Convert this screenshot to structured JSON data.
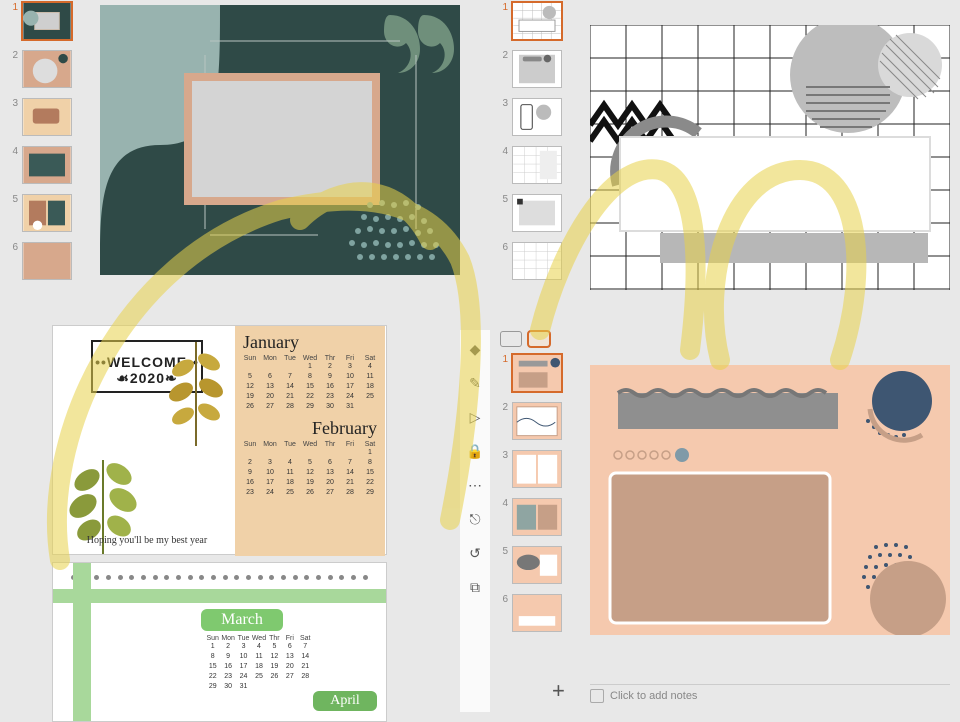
{
  "panel_tl": {
    "thumbs": [
      1,
      2,
      3,
      4,
      5,
      6
    ],
    "selected": 1
  },
  "panel_tr": {
    "thumbs": [
      1,
      2,
      3,
      4,
      5,
      6
    ],
    "selected": 1
  },
  "panel_br": {
    "thumbs": [
      1,
      2,
      3,
      4,
      5,
      6
    ],
    "selected": 1,
    "notes_placeholder": "Click to add notes",
    "add_slide_glyph": "+"
  },
  "calendar": {
    "welcome_title": "••WELCOME••",
    "welcome_year": "☙2020❧",
    "welcome_msg": "Hoping you'll be my best year",
    "months": {
      "jan": {
        "label": "January",
        "dow": [
          "Sun",
          "Mon",
          "Tue",
          "Wed",
          "Thr",
          "Fri",
          "Sat"
        ],
        "rows": [
          [
            "",
            "",
            "",
            "1",
            "2",
            "3",
            "4"
          ],
          [
            "5",
            "6",
            "7",
            "8",
            "9",
            "10",
            "11"
          ],
          [
            "12",
            "13",
            "14",
            "15",
            "16",
            "17",
            "18"
          ],
          [
            "19",
            "20",
            "21",
            "22",
            "23",
            "24",
            "25"
          ],
          [
            "26",
            "27",
            "28",
            "29",
            "30",
            "31",
            ""
          ]
        ]
      },
      "feb": {
        "label": "February",
        "dow": [
          "Sun",
          "Mon",
          "Tue",
          "Wed",
          "Thr",
          "Fri",
          "Sat"
        ],
        "rows": [
          [
            "",
            "",
            "",
            "",
            "",
            "",
            "1"
          ],
          [
            "2",
            "3",
            "4",
            "5",
            "6",
            "7",
            "8"
          ],
          [
            "9",
            "10",
            "11",
            "12",
            "13",
            "14",
            "15"
          ],
          [
            "16",
            "17",
            "18",
            "19",
            "20",
            "21",
            "22"
          ],
          [
            "23",
            "24",
            "25",
            "26",
            "27",
            "28",
            "29"
          ]
        ]
      },
      "mar": {
        "label": "March",
        "dow": [
          "Sun",
          "Mon",
          "Tue",
          "Wed",
          "Thr",
          "Fri",
          "Sat"
        ],
        "rows": [
          [
            "1",
            "2",
            "3",
            "4",
            "5",
            "6",
            "7"
          ],
          [
            "8",
            "9",
            "10",
            "11",
            "12",
            "13",
            "14"
          ],
          [
            "15",
            "16",
            "17",
            "18",
            "19",
            "20",
            "21"
          ],
          [
            "22",
            "23",
            "24",
            "25",
            "26",
            "27",
            "28"
          ],
          [
            "29",
            "30",
            "31",
            "",
            "",
            "",
            ""
          ]
        ]
      },
      "apr": {
        "label": "April"
      }
    }
  },
  "tools": {
    "icons": [
      "◆",
      "✎",
      "▷",
      "🔒",
      "⋯",
      "⎋",
      "↺",
      "⧉"
    ]
  },
  "view_toggle": {
    "options": [
      "list",
      "grid"
    ]
  },
  "colors": {
    "accent": "#d56a2b",
    "teal_dark": "#2f4a47",
    "teal_light": "#98b3af",
    "blush": "#d7a88c",
    "peach": "#f0d1a8",
    "salmon": "#f5c9ae",
    "navy": "#3e5672",
    "olive": "#8a9a5b",
    "green": "#7fc96f"
  }
}
